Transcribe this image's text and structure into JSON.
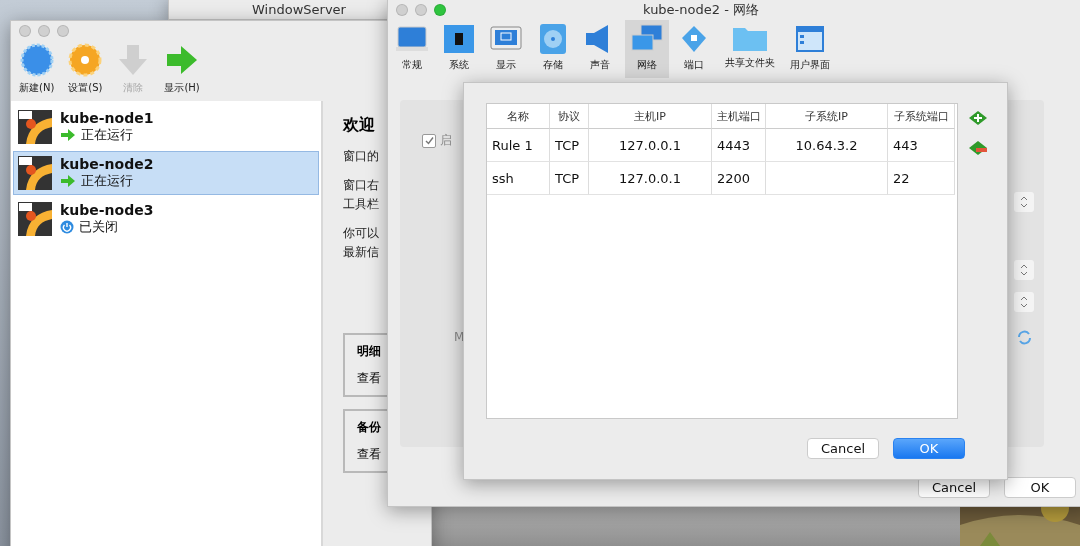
{
  "background_window": {
    "title": "WindowServer"
  },
  "manager": {
    "toolbar": [
      {
        "label": "新建(N)",
        "disabled": false
      },
      {
        "label": "设置(S)",
        "disabled": false
      },
      {
        "label": "清除",
        "disabled": true
      },
      {
        "label": "显示(H)",
        "disabled": false
      }
    ],
    "vms": [
      {
        "name": "kube-node1",
        "status": "正在运行",
        "kind": "running",
        "selected": false
      },
      {
        "name": "kube-node2",
        "status": "正在运行",
        "kind": "running",
        "selected": true
      },
      {
        "name": "kube-node3",
        "status": "已关闭",
        "kind": "off",
        "selected": false
      }
    ],
    "welcome": {
      "heading": "欢迎",
      "paragraphs": [
        [
          "窗口的"
        ],
        [
          "窗口右",
          "工具栏"
        ],
        [
          "你可以",
          "最新信"
        ]
      ]
    },
    "cards": [
      {
        "title": "明细",
        "text": "查看"
      },
      {
        "title": "备份",
        "text": "查看"
      }
    ]
  },
  "settings": {
    "title": "kube-node2 - 网络",
    "tabs": [
      {
        "label": "常规",
        "selected": false
      },
      {
        "label": "系统",
        "selected": false
      },
      {
        "label": "显示",
        "selected": false
      },
      {
        "label": "存储",
        "selected": false
      },
      {
        "label": "声音",
        "selected": false
      },
      {
        "label": "网络",
        "selected": true
      },
      {
        "label": "端口",
        "selected": false
      },
      {
        "label": "共享文件夹",
        "selected": false
      },
      {
        "label": "用户界面",
        "selected": false
      }
    ],
    "enable": {
      "label": "启",
      "checked": true
    },
    "partial_label": "M",
    "buttons": [
      {
        "label": "Cancel",
        "default": false
      },
      {
        "label": "OK",
        "default": false
      }
    ]
  },
  "dialog": {
    "columns": [
      "名称",
      "协议",
      "主机IP",
      "主机端口",
      "子系统IP",
      "子系统端口"
    ],
    "rows": [
      [
        "Rule 1",
        "TCP",
        "127.0.0.1",
        "4443",
        "10.64.3.2",
        "443"
      ],
      [
        "ssh",
        "TCP",
        "127.0.0.1",
        "2200",
        "",
        "22"
      ]
    ],
    "buttons": [
      {
        "label": "Cancel",
        "default": false
      },
      {
        "label": "OK",
        "default": true
      }
    ]
  }
}
